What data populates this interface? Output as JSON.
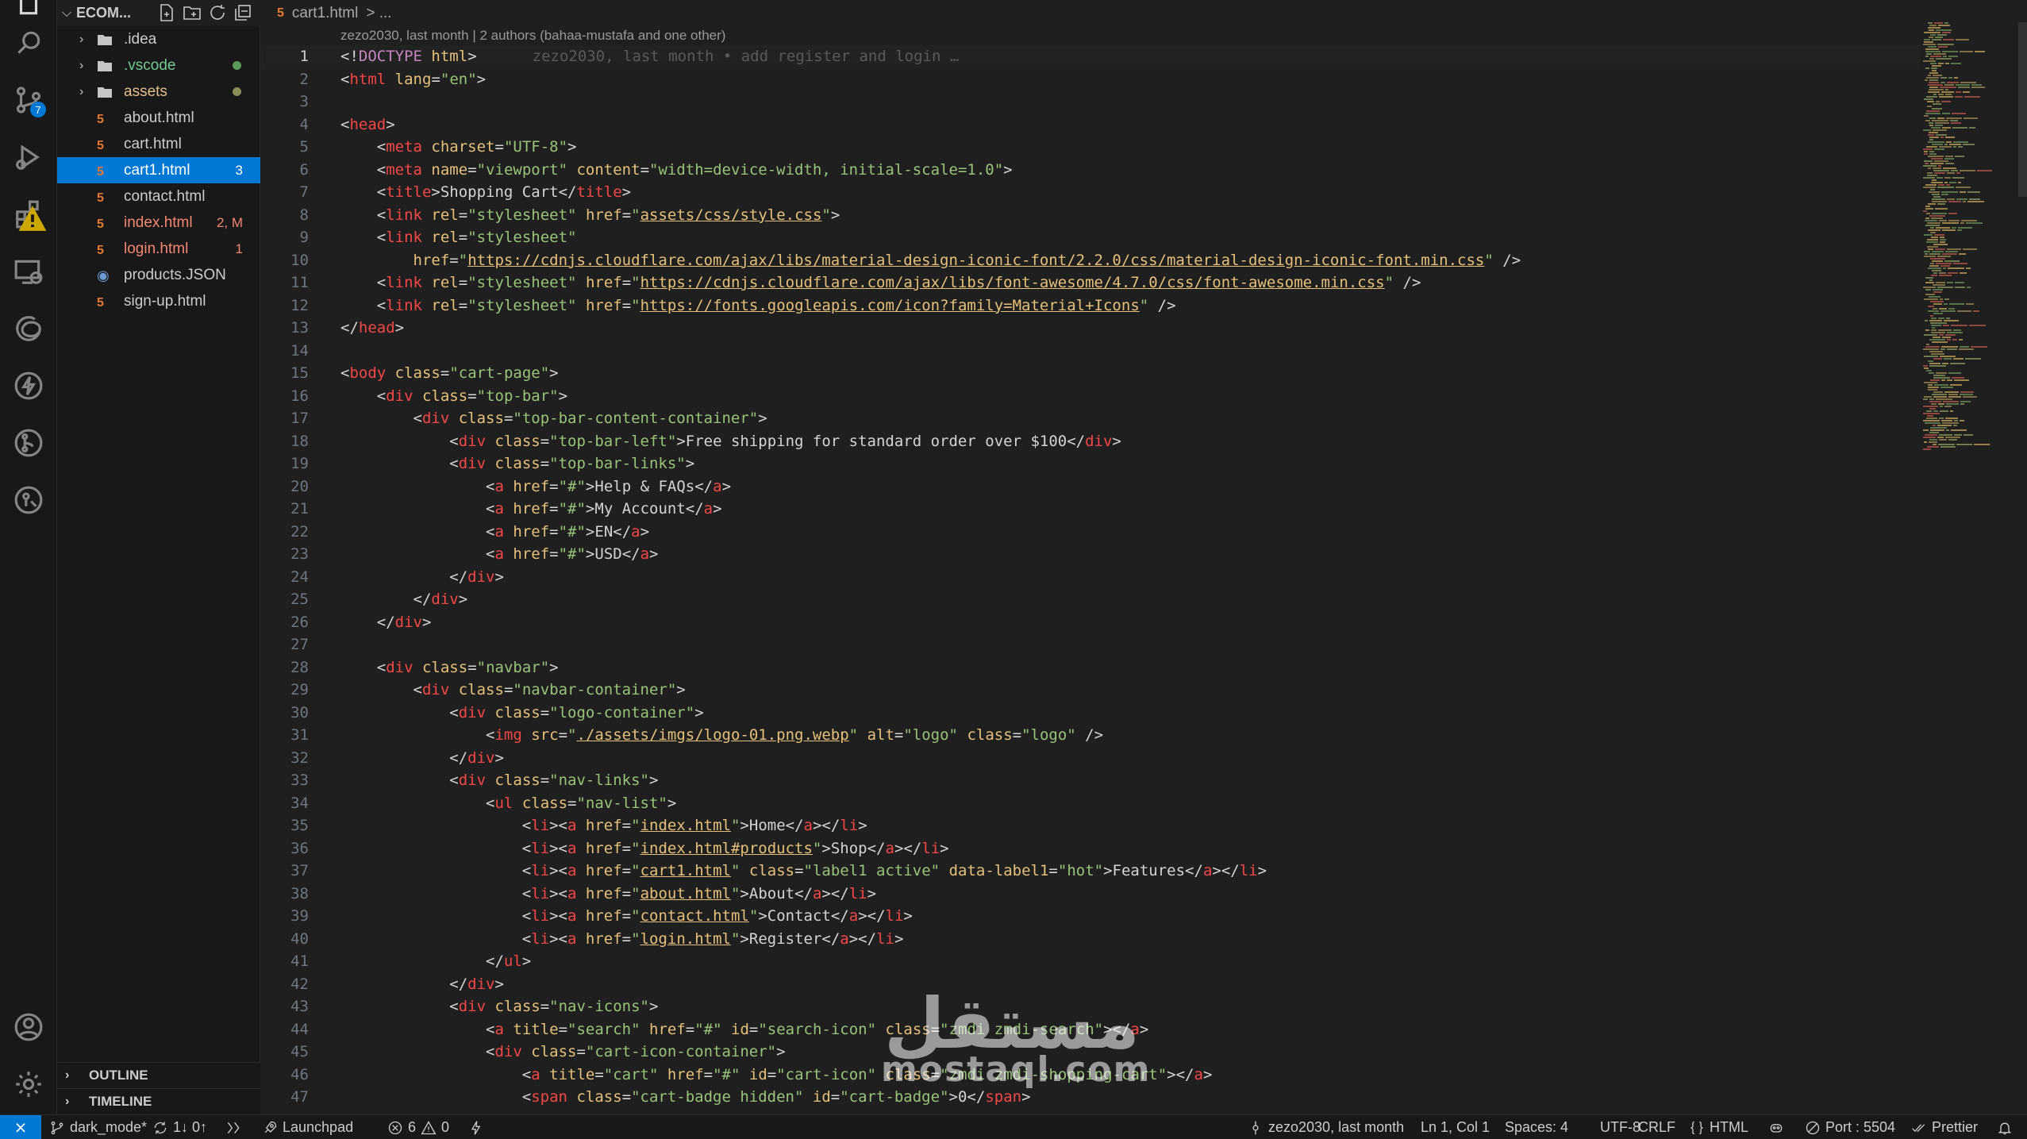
{
  "activity_bar": {
    "icons": [
      "explorer-icon",
      "search-icon",
      "source-control-icon",
      "run-debug-icon",
      "extensions-icon",
      "remote-explorer-icon",
      "edge-icon",
      "thunder-icon",
      "gitlens-icon",
      "git-graph-icon",
      "account-icon",
      "settings-gear-icon"
    ],
    "source_control_badge": "7"
  },
  "explorer": {
    "title": "ECOM...",
    "files": [
      {
        "name": ".idea",
        "type": "folder",
        "status": "",
        "color": "#cccccc"
      },
      {
        "name": ".vscode",
        "type": "folder",
        "status": "",
        "dot": "#5a9a5a",
        "color": "#73c991"
      },
      {
        "name": "assets",
        "type": "folder",
        "status": "",
        "dot": "#8a8d5a",
        "color": "#e2c08d"
      },
      {
        "name": "about.html",
        "type": "html",
        "status": "",
        "color": "#cccccc"
      },
      {
        "name": "cart.html",
        "type": "html",
        "status": "",
        "color": "#cccccc"
      },
      {
        "name": "cart1.html",
        "type": "html",
        "status": "3",
        "color": "#ffffff"
      },
      {
        "name": "contact.html",
        "type": "html",
        "status": "",
        "color": "#cccccc"
      },
      {
        "name": "index.html",
        "type": "html",
        "status": "2, M",
        "color": "#f48771"
      },
      {
        "name": "login.html",
        "type": "html",
        "status": "1",
        "color": "#f48771"
      },
      {
        "name": "products.JSON",
        "type": "json",
        "status": "",
        "color": "#cccccc"
      },
      {
        "name": "sign-up.html",
        "type": "html",
        "status": "",
        "color": "#cccccc"
      }
    ],
    "outline_label": "OUTLINE",
    "timeline_label": "TIMELINE"
  },
  "editor": {
    "breadcrumb_file": "cart1.html",
    "breadcrumb_rest": "> ...",
    "blame_header": "zezo2030, last month | 2 authors (bahaa-mustafa and one other)",
    "inline_blame": "zezo2030, last month • add register and login …"
  },
  "watermark": {
    "arabic": "مستقل",
    "latin": "mostaql.com"
  },
  "status_bar": {
    "branch": "dark_mode*",
    "sync": "1↓ 0↑",
    "launchpad": "Launchpad",
    "errors": "6",
    "warnings": "0",
    "blame": "zezo2030, last month",
    "position": "Ln 1, Col 1",
    "spaces": "Spaces: 4",
    "encoding": "UTF-8",
    "eol": "CRLF",
    "language": "HTML",
    "port": "Port : 5504",
    "formatter": "Prettier"
  }
}
